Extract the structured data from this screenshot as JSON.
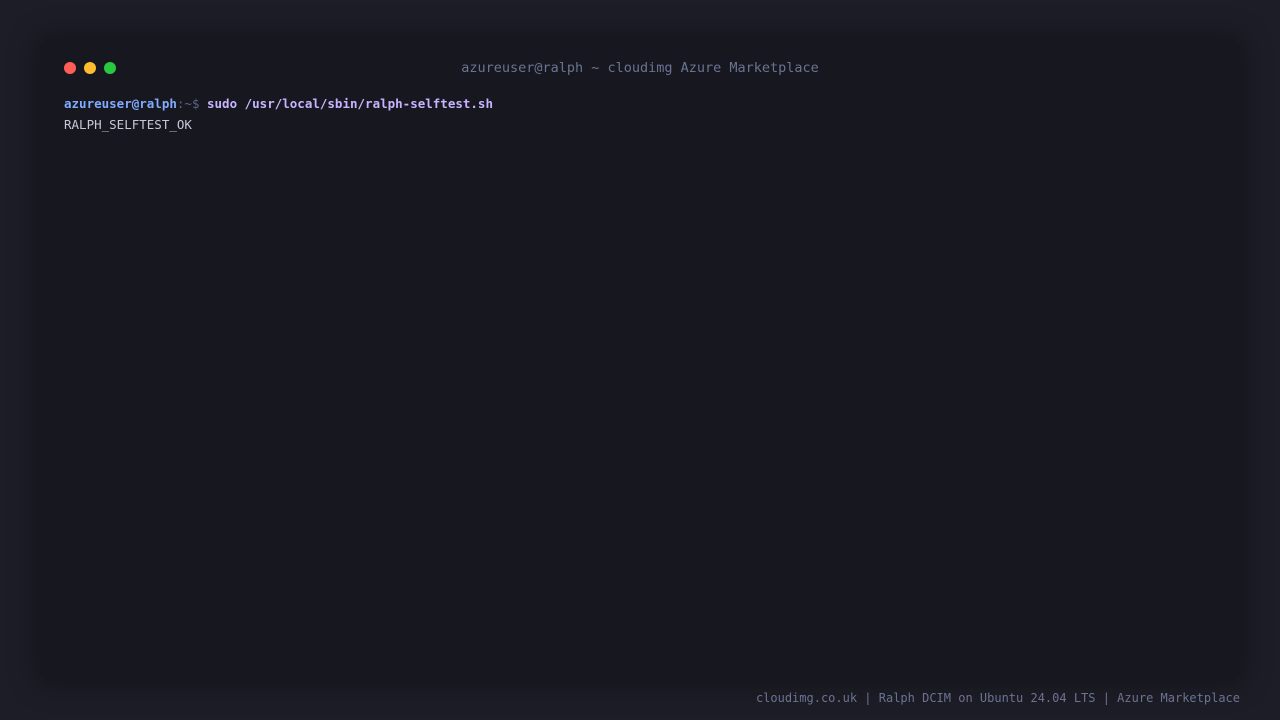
{
  "window": {
    "title": "azureuser@ralph ~ cloudimg Azure Marketplace",
    "controls": [
      "close",
      "minimize",
      "maximize"
    ]
  },
  "terminal": {
    "lines": [
      {
        "prompt_user": "azureuser@ralph",
        "prompt_suffix": ":~$ ",
        "command": "sudo /usr/local/sbin/ralph-selftest.sh"
      },
      {
        "output": "RALPH_SELFTEST_OK"
      }
    ]
  },
  "footer": {
    "text": "cloudimg.co.uk | Ralph DCIM on Ubuntu 24.04 LTS | Azure Marketplace"
  },
  "colors": {
    "background": "#1c1d26",
    "window": "#16171f",
    "prompt_user": "#82aaff",
    "command": "#c9b3ff",
    "output": "#c5c9d6",
    "close": "#ff5f57",
    "minimize": "#febc2e",
    "maximize": "#28c840"
  }
}
